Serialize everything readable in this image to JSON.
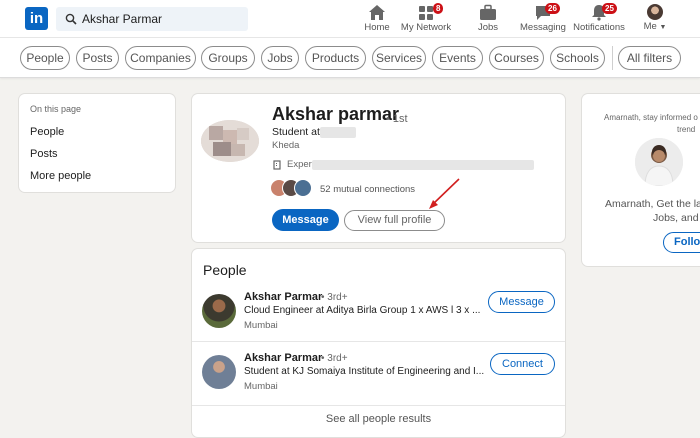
{
  "nav": {
    "logo": "in",
    "search_value": "Akshar Parmar",
    "items": [
      {
        "label": "Home",
        "icon": "home-icon",
        "badge": ""
      },
      {
        "label": "My Network",
        "icon": "my-network-icon",
        "badge": "8"
      },
      {
        "label": "Jobs",
        "icon": "jobs-icon",
        "badge": ""
      },
      {
        "label": "Messaging",
        "icon": "messaging-icon",
        "badge": "26"
      },
      {
        "label": "Notifications",
        "icon": "notifications-icon",
        "badge": "25"
      },
      {
        "label": "Me",
        "icon": "me-avatar",
        "badge": ""
      }
    ]
  },
  "filters": [
    "People",
    "Posts",
    "Companies",
    "Groups",
    "Jobs",
    "Products",
    "Services",
    "Events",
    "Courses",
    "Schools"
  ],
  "all_filters": "All filters",
  "left_nav": {
    "title": "On this page",
    "links": [
      "People",
      "Posts",
      "More people"
    ]
  },
  "profile": {
    "name": "Akshar parmar",
    "degree": "• 1st",
    "headline": "Student at",
    "location": "Kheda",
    "experience_prefix": "Exper",
    "mutual": "52 mutual connections",
    "message_label": "Message",
    "view_profile_label": "View full profile"
  },
  "people_section": {
    "title": "People",
    "results": [
      {
        "name": "Akshar Parmar",
        "degree": "• 3rd+",
        "headline": "Cloud Engineer at Aditya Birla Group 1 x AWS l 3 x ...",
        "location": "Mumbai",
        "action": "Message"
      },
      {
        "name": "Akshar Parmar",
        "degree": "• 3rd+",
        "headline": "Student at KJ Somaiya Institute of Engineering and I...",
        "location": "Mumbai",
        "action": "Connect"
      }
    ],
    "see_all": "See all people results"
  },
  "right_card": {
    "line1": "Amarnath, stay informed o",
    "line2": "trend",
    "line3": "Amarnath, Get the la",
    "line4": "Jobs, and",
    "follow_label": "Follo"
  },
  "colors": {
    "brand": "#0a66c2",
    "badge": "#cc1016",
    "arrow": "#d11f1f"
  }
}
